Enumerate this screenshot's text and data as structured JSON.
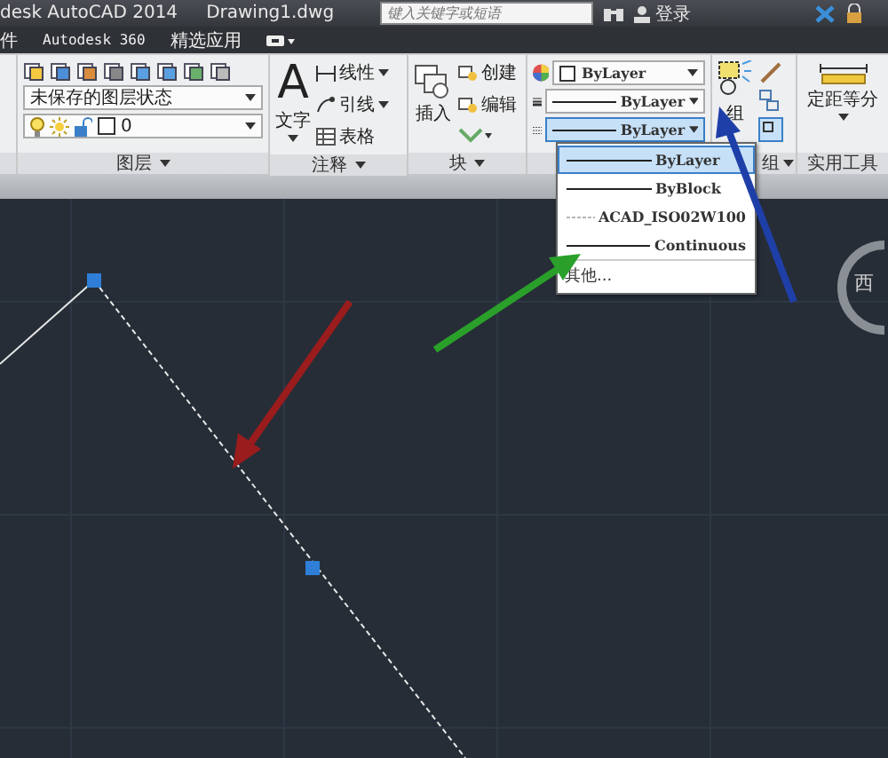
{
  "title_bar": {
    "app_title": "desk AutoCAD 2014",
    "file_name": "Drawing1.dwg",
    "search": {
      "placeholder": "键入关键字或短语"
    },
    "sign_in": "登录"
  },
  "menu_bar": {
    "items": [
      "件",
      "Autodesk 360",
      "精选应用"
    ]
  },
  "ribbon": {
    "layers": {
      "title": "图层",
      "layer_state": "未保存的图层状态",
      "current_layer": "0"
    },
    "annotation": {
      "title": "注释",
      "text_icon": "A",
      "big_button": "文字",
      "items": [
        "线性",
        "引线",
        "表格"
      ]
    },
    "block": {
      "title": "块",
      "big_button": "插入",
      "items": [
        "创建",
        "编辑"
      ]
    },
    "properties": {
      "color_setting": "ByLayer",
      "lineweight": "ByLayer",
      "linetype": {
        "value": "ByLayer",
        "expanded": true
      }
    },
    "group": {
      "big_button": "组",
      "title": "组"
    },
    "utilities": {
      "big_button": "定距等分",
      "title": "实用工具"
    }
  },
  "linetype_list": {
    "options": [
      {
        "label": "ByLayer",
        "kind": "solid",
        "selected": true
      },
      {
        "label": "ByBlock",
        "kind": "solid",
        "selected": false
      },
      {
        "label": "ACAD_ISO02W100",
        "kind": "dashed",
        "selected": false
      },
      {
        "label": "Continuous",
        "kind": "solid",
        "selected": false
      }
    ],
    "footer": "其他..."
  },
  "canvas": {
    "viewcube_label": "西"
  }
}
